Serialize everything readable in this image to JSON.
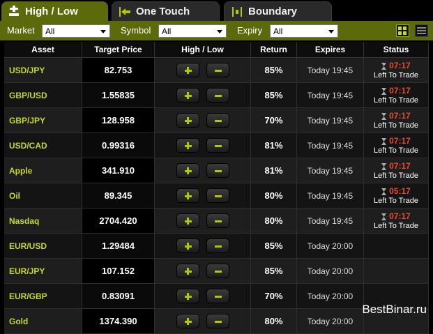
{
  "tabs": [
    {
      "label": "High / Low",
      "icon": "high-low-icon",
      "active": true
    },
    {
      "label": "One Touch",
      "icon": "one-touch-icon",
      "active": false
    },
    {
      "label": "Boundary",
      "icon": "boundary-icon",
      "active": false
    }
  ],
  "filters": {
    "market_label": "Market",
    "market_value": "All",
    "symbol_label": "Symbol",
    "symbol_value": "All",
    "expiry_label": "Expiry",
    "expiry_value": "All"
  },
  "columns": {
    "asset": "Asset",
    "target_price": "Target Price",
    "high_low": "High / Low",
    "return": "Return",
    "expires": "Expires",
    "status": "Status"
  },
  "rows": [
    {
      "asset": "USD/JPY",
      "price": "82.753",
      "return": "85%",
      "expires": "Today 19:45",
      "status_time": "07:17",
      "status_label": "Left To Trade"
    },
    {
      "asset": "GBP/USD",
      "price": "1.55835",
      "return": "85%",
      "expires": "Today 19:45",
      "status_time": "07:17",
      "status_label": "Left To Trade"
    },
    {
      "asset": "GBP/JPY",
      "price": "128.958",
      "return": "70%",
      "expires": "Today 19:45",
      "status_time": "07:17",
      "status_label": "Left To Trade"
    },
    {
      "asset": "USD/CAD",
      "price": "0.99316",
      "return": "81%",
      "expires": "Today 19:45",
      "status_time": "07:17",
      "status_label": "Left To Trade"
    },
    {
      "asset": "Apple",
      "price": "341.910",
      "return": "81%",
      "expires": "Today 19:45",
      "status_time": "07:17",
      "status_label": "Left To Trade"
    },
    {
      "asset": "Oil",
      "price": "89.345",
      "return": "80%",
      "expires": "Today 19:45",
      "status_time": "05:17",
      "status_label": "Left To Trade"
    },
    {
      "asset": "Nasdaq",
      "price": "2704.420",
      "return": "80%",
      "expires": "Today 19:45",
      "status_time": "07:17",
      "status_label": "Left To Trade"
    },
    {
      "asset": "EUR/USD",
      "price": "1.29484",
      "return": "85%",
      "expires": "Today 20:00",
      "status_time": "",
      "status_label": ""
    },
    {
      "asset": "EUR/JPY",
      "price": "107.152",
      "return": "85%",
      "expires": "Today 20:00",
      "status_time": "",
      "status_label": ""
    },
    {
      "asset": "EUR/GBP",
      "price": "0.83091",
      "return": "70%",
      "expires": "Today 20:00",
      "status_time": "",
      "status_label": ""
    },
    {
      "asset": "Gold",
      "price": "1374.390",
      "return": "80%",
      "expires": "Today 20:00",
      "status_time": "",
      "status_label": ""
    }
  ],
  "watermark": "BestBinar.ru",
  "colors": {
    "accent": "#5d6a0c",
    "asset_text": "#c8d92a",
    "button_icon": "#b5c700",
    "time_remaining": "#e94a2e"
  }
}
